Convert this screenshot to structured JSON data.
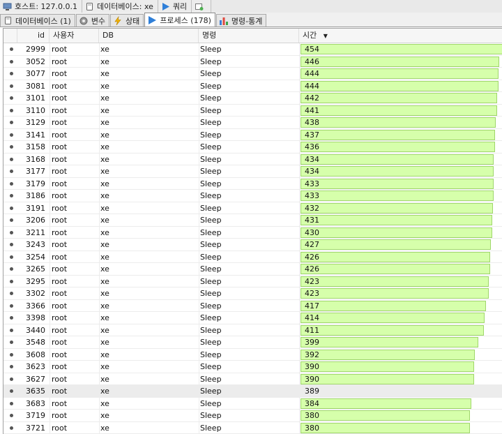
{
  "top_tabs": [
    {
      "label": "호스트: 127.0.0.1",
      "icon": "host-icon"
    },
    {
      "label": "데이터베이스: xe",
      "icon": "database-icon"
    },
    {
      "label": "쿼리",
      "icon": "play-icon"
    },
    {
      "label": "",
      "icon": "new-query-icon"
    }
  ],
  "sub_tabs": [
    {
      "label": "데이터베이스 (1)",
      "icon": "database-icon",
      "active": false
    },
    {
      "label": "변수",
      "icon": "gear-icon",
      "active": false
    },
    {
      "label": "상태",
      "icon": "lightning-icon",
      "active": false
    },
    {
      "label": "프로세스 (178)",
      "icon": "play-icon",
      "active": true
    },
    {
      "label": "명령-통계",
      "icon": "chart-icon",
      "active": false
    }
  ],
  "columns": {
    "id": "id",
    "user": "사용자",
    "db": "DB",
    "command": "명령",
    "time": "시간"
  },
  "sort_indicator": "▼",
  "colors": {
    "bar_fill": "#d6ffab",
    "bar_border": "#9fd66a"
  },
  "rows": [
    {
      "id": "2999",
      "user": "root",
      "db": "xe",
      "command": "Sleep",
      "time": 454
    },
    {
      "id": "3052",
      "user": "root",
      "db": "xe",
      "command": "Sleep",
      "time": 446
    },
    {
      "id": "3077",
      "user": "root",
      "db": "xe",
      "command": "Sleep",
      "time": 444
    },
    {
      "id": "3081",
      "user": "root",
      "db": "xe",
      "command": "Sleep",
      "time": 444
    },
    {
      "id": "3101",
      "user": "root",
      "db": "xe",
      "command": "Sleep",
      "time": 442
    },
    {
      "id": "3110",
      "user": "root",
      "db": "xe",
      "command": "Sleep",
      "time": 441
    },
    {
      "id": "3129",
      "user": "root",
      "db": "xe",
      "command": "Sleep",
      "time": 438
    },
    {
      "id": "3141",
      "user": "root",
      "db": "xe",
      "command": "Sleep",
      "time": 437
    },
    {
      "id": "3158",
      "user": "root",
      "db": "xe",
      "command": "Sleep",
      "time": 436
    },
    {
      "id": "3168",
      "user": "root",
      "db": "xe",
      "command": "Sleep",
      "time": 434
    },
    {
      "id": "3177",
      "user": "root",
      "db": "xe",
      "command": "Sleep",
      "time": 434
    },
    {
      "id": "3179",
      "user": "root",
      "db": "xe",
      "command": "Sleep",
      "time": 433
    },
    {
      "id": "3186",
      "user": "root",
      "db": "xe",
      "command": "Sleep",
      "time": 433
    },
    {
      "id": "3191",
      "user": "root",
      "db": "xe",
      "command": "Sleep",
      "time": 432
    },
    {
      "id": "3206",
      "user": "root",
      "db": "xe",
      "command": "Sleep",
      "time": 431
    },
    {
      "id": "3211",
      "user": "root",
      "db": "xe",
      "command": "Sleep",
      "time": 430
    },
    {
      "id": "3243",
      "user": "root",
      "db": "xe",
      "command": "Sleep",
      "time": 427
    },
    {
      "id": "3254",
      "user": "root",
      "db": "xe",
      "command": "Sleep",
      "time": 426
    },
    {
      "id": "3265",
      "user": "root",
      "db": "xe",
      "command": "Sleep",
      "time": 426
    },
    {
      "id": "3295",
      "user": "root",
      "db": "xe",
      "command": "Sleep",
      "time": 423
    },
    {
      "id": "3302",
      "user": "root",
      "db": "xe",
      "command": "Sleep",
      "time": 423
    },
    {
      "id": "3366",
      "user": "root",
      "db": "xe",
      "command": "Sleep",
      "time": 417
    },
    {
      "id": "3398",
      "user": "root",
      "db": "xe",
      "command": "Sleep",
      "time": 414
    },
    {
      "id": "3440",
      "user": "root",
      "db": "xe",
      "command": "Sleep",
      "time": 411
    },
    {
      "id": "3548",
      "user": "root",
      "db": "xe",
      "command": "Sleep",
      "time": 399
    },
    {
      "id": "3608",
      "user": "root",
      "db": "xe",
      "command": "Sleep",
      "time": 392
    },
    {
      "id": "3623",
      "user": "root",
      "db": "xe",
      "command": "Sleep",
      "time": 390
    },
    {
      "id": "3627",
      "user": "root",
      "db": "xe",
      "command": "Sleep",
      "time": 390
    },
    {
      "id": "3635",
      "user": "root",
      "db": "xe",
      "command": "Sleep",
      "time": 389,
      "selected": true
    },
    {
      "id": "3683",
      "user": "root",
      "db": "xe",
      "command": "Sleep",
      "time": 384
    },
    {
      "id": "3719",
      "user": "root",
      "db": "xe",
      "command": "Sleep",
      "time": 380
    },
    {
      "id": "3721",
      "user": "root",
      "db": "xe",
      "command": "Sleep",
      "time": 380
    }
  ]
}
